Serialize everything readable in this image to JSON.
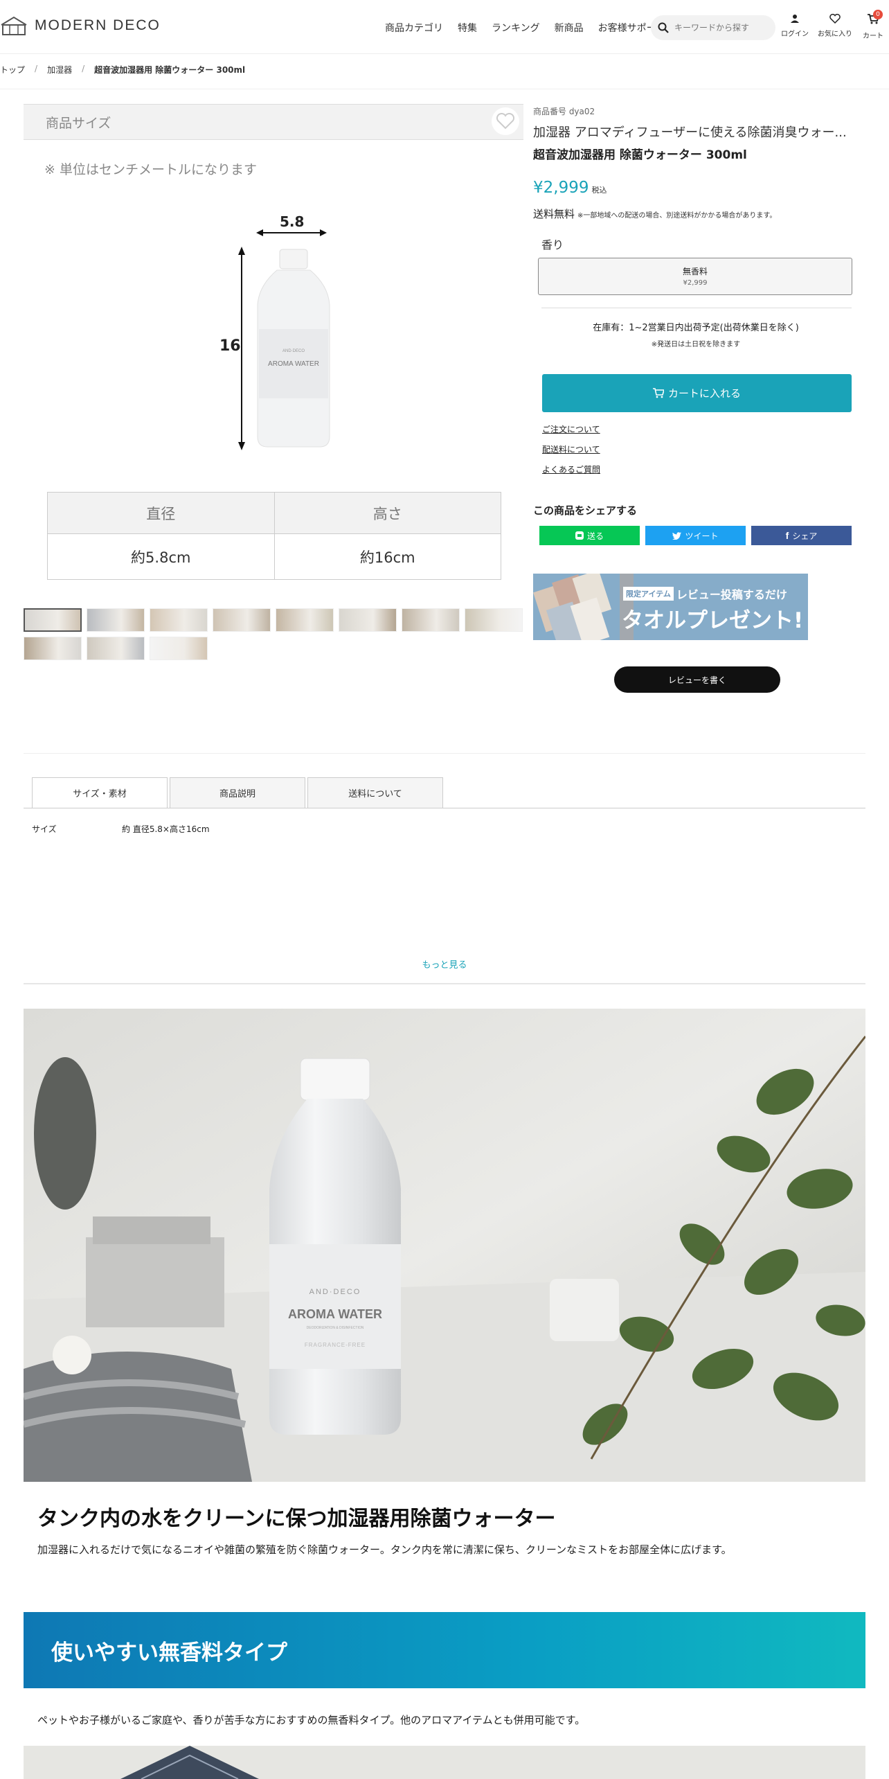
{
  "header": {
    "logo_text": "MODERN DECO",
    "nav": [
      "商品カテゴリ",
      "特集",
      "ランキング",
      "新商品",
      "お客様サポート"
    ],
    "search_placeholder": "キーワードから探す",
    "login_label": "ログイン",
    "favorites_label": "お気に入り",
    "cart_label": "カート",
    "cart_count": "0"
  },
  "breadcrumb": {
    "items": [
      "トップ",
      "加湿器",
      "超音波加湿器用 除菌ウォーター 300ml"
    ]
  },
  "gallery": {
    "size_header": "商品サイズ",
    "unit_note": "※ 単位はセンチメートルになります",
    "bottle_brand": "AND·DECO",
    "bottle_label": "AROMA WATER",
    "dim_width": "5.8",
    "dim_height": "16",
    "table_headers": [
      "直径",
      "高さ"
    ],
    "table_values": [
      "約5.8cm",
      "約16cm"
    ],
    "thumbnail_count": 11
  },
  "product": {
    "sku": "商品番号 dya02",
    "title": "加湿器 アロマディフューザーに使える除菌消臭ウォー...",
    "subtitle": "超音波加湿器用 除菌ウォーター 300ml",
    "price": "¥2,999",
    "tax_label": "税込",
    "shipping": "送料無料",
    "shipping_note": "※一部地域への配送の場合、別途送料がかかる場合があります。",
    "scent_label": "香り",
    "scent_option_name": "無香料",
    "scent_option_price": "¥2,999",
    "stock_text": "在庫有：1~2営業日内出荷予定(出荷休業日を除く)",
    "stock_note": "※発送日は土日祝を除きます",
    "cart_button": "カートに入れる",
    "links": [
      "ご注文について",
      "配送料について",
      "よくあるご質問"
    ],
    "share_title": "この商品をシェアする",
    "share_buttons": [
      "送る",
      "ツイート",
      "シェア"
    ],
    "promo_tag": "限定アイテム",
    "promo_line1": "レビュー投稿するだけ",
    "promo_line2": "タオルプレゼント!",
    "review_button": "レビューを書く"
  },
  "tabs": {
    "items": [
      "サイズ・素材",
      "商品説明",
      "送料について"
    ],
    "active": 0,
    "spec_key": "サイズ",
    "spec_value": "約 直径5.8×高さ16cm",
    "more_link": "もっと見る"
  },
  "content": {
    "hero_brand": "AND·DECO",
    "hero_label": "AROMA WATER",
    "hero_sublabel": "DEODORIZATION & DISINFECTION",
    "hero_fragrance": "FRAGRANCE-FREE",
    "heading1": "タンク内の水をクリーンに保つ加湿器用除菌ウォーター",
    "para1": "加湿器に入れるだけで気になるニオイや雑菌の繁殖を防ぐ除菌ウォーター。タンク内を常に清潔に保ち、クリーンなミストをお部屋全体に広げます。",
    "banner_heading": "使いやすい無香料タイプ",
    "para2": "ペットやお子様がいるご家庭や、香りが苦手な方におすすめの無香料タイプ。他のアロマアイテムとも併用可能です。"
  },
  "colors": {
    "accent": "#1aa3b8",
    "line_green": "#06c755",
    "twitter_blue": "#1da1f2",
    "facebook_blue": "#3b5998"
  }
}
